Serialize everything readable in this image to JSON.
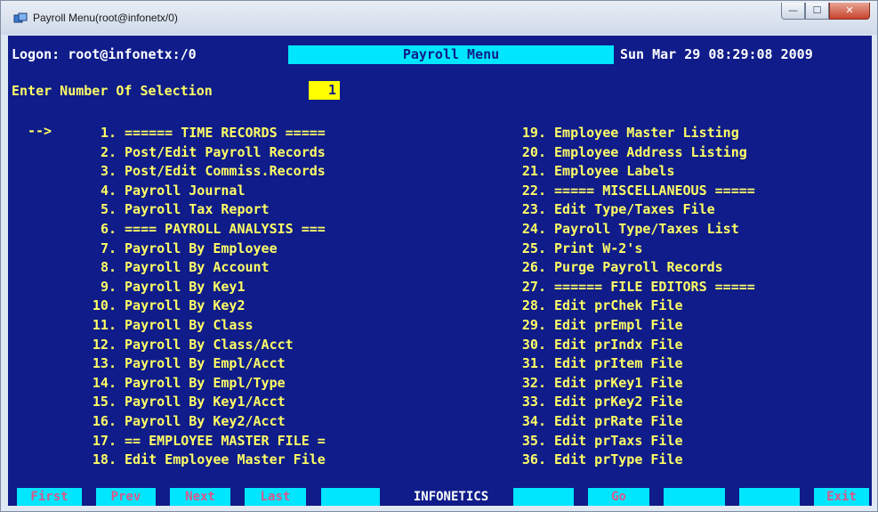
{
  "window": {
    "title": "Payroll Menu(root@infonetx/0)",
    "buttons": {
      "minimize": "—",
      "maximize": "☐",
      "close": "✕"
    }
  },
  "header": {
    "logon": "Logon: root@infonetx:/0",
    "menu_title": "Payroll Menu",
    "datetime": "Sun Mar 29 08:29:08 2009"
  },
  "prompt": {
    "label": "Enter Number Of Selection",
    "value": "1"
  },
  "pointer": "-->",
  "menu_left": [
    {
      "num": "1.",
      "label": "====== TIME RECORDS ====="
    },
    {
      "num": "2.",
      "label": "Post/Edit Payroll Records"
    },
    {
      "num": "3.",
      "label": "Post/Edit Commiss.Records"
    },
    {
      "num": "4.",
      "label": "Payroll Journal"
    },
    {
      "num": "5.",
      "label": "Payroll Tax Report"
    },
    {
      "num": "6.",
      "label": "==== PAYROLL ANALYSIS ==="
    },
    {
      "num": "7.",
      "label": "Payroll By Employee"
    },
    {
      "num": "8.",
      "label": "Payroll By Account"
    },
    {
      "num": "9.",
      "label": "Payroll By Key1"
    },
    {
      "num": "10.",
      "label": "Payroll By Key2"
    },
    {
      "num": "11.",
      "label": "Payroll By Class"
    },
    {
      "num": "12.",
      "label": "Payroll By Class/Acct"
    },
    {
      "num": "13.",
      "label": "Payroll By Empl/Acct"
    },
    {
      "num": "14.",
      "label": "Payroll By Empl/Type"
    },
    {
      "num": "15.",
      "label": "Payroll By Key1/Acct"
    },
    {
      "num": "16.",
      "label": "Payroll By Key2/Acct"
    },
    {
      "num": "17.",
      "label": "== EMPLOYEE MASTER FILE ="
    },
    {
      "num": "18.",
      "label": "Edit Employee Master File"
    }
  ],
  "menu_right": [
    {
      "num": "19.",
      "label": "Employee Master Listing"
    },
    {
      "num": "20.",
      "label": "Employee Address Listing"
    },
    {
      "num": "21.",
      "label": "Employee Labels"
    },
    {
      "num": "22.",
      "label": "===== MISCELLANEOUS ====="
    },
    {
      "num": "23.",
      "label": "Edit Type/Taxes File"
    },
    {
      "num": "24.",
      "label": "Payroll Type/Taxes List"
    },
    {
      "num": "25.",
      "label": "Print W-2's"
    },
    {
      "num": "26.",
      "label": "Purge Payroll Records"
    },
    {
      "num": "27.",
      "label": "====== FILE EDITORS ====="
    },
    {
      "num": "28.",
      "label": "Edit prChek File"
    },
    {
      "num": "29.",
      "label": "Edit prEmpl File"
    },
    {
      "num": "30.",
      "label": "Edit prIndx File"
    },
    {
      "num": "31.",
      "label": "Edit prItem File"
    },
    {
      "num": "32.",
      "label": "Edit prKey1 File"
    },
    {
      "num": "33.",
      "label": "Edit prKey2 File"
    },
    {
      "num": "34.",
      "label": "Edit prRate File"
    },
    {
      "num": "35.",
      "label": "Edit prTaxs File"
    },
    {
      "num": "36.",
      "label": "Edit prType File"
    }
  ],
  "function_keys": {
    "first": "First",
    "prev": "Prev",
    "next": "Next",
    "last": "Last",
    "blank1": "",
    "infonetics": "INFONETICS",
    "blank2": "",
    "go": "Go",
    "blank3": "",
    "blank4": "",
    "exit": "Exit"
  },
  "colors": {
    "screen_bg": "#0f1c8a",
    "menu_text": "#ffff66",
    "header_text": "#ffffff",
    "title_bar": "#00e6ff",
    "selection_bg": "#ffff00",
    "fn_text": "#d65a8c"
  }
}
